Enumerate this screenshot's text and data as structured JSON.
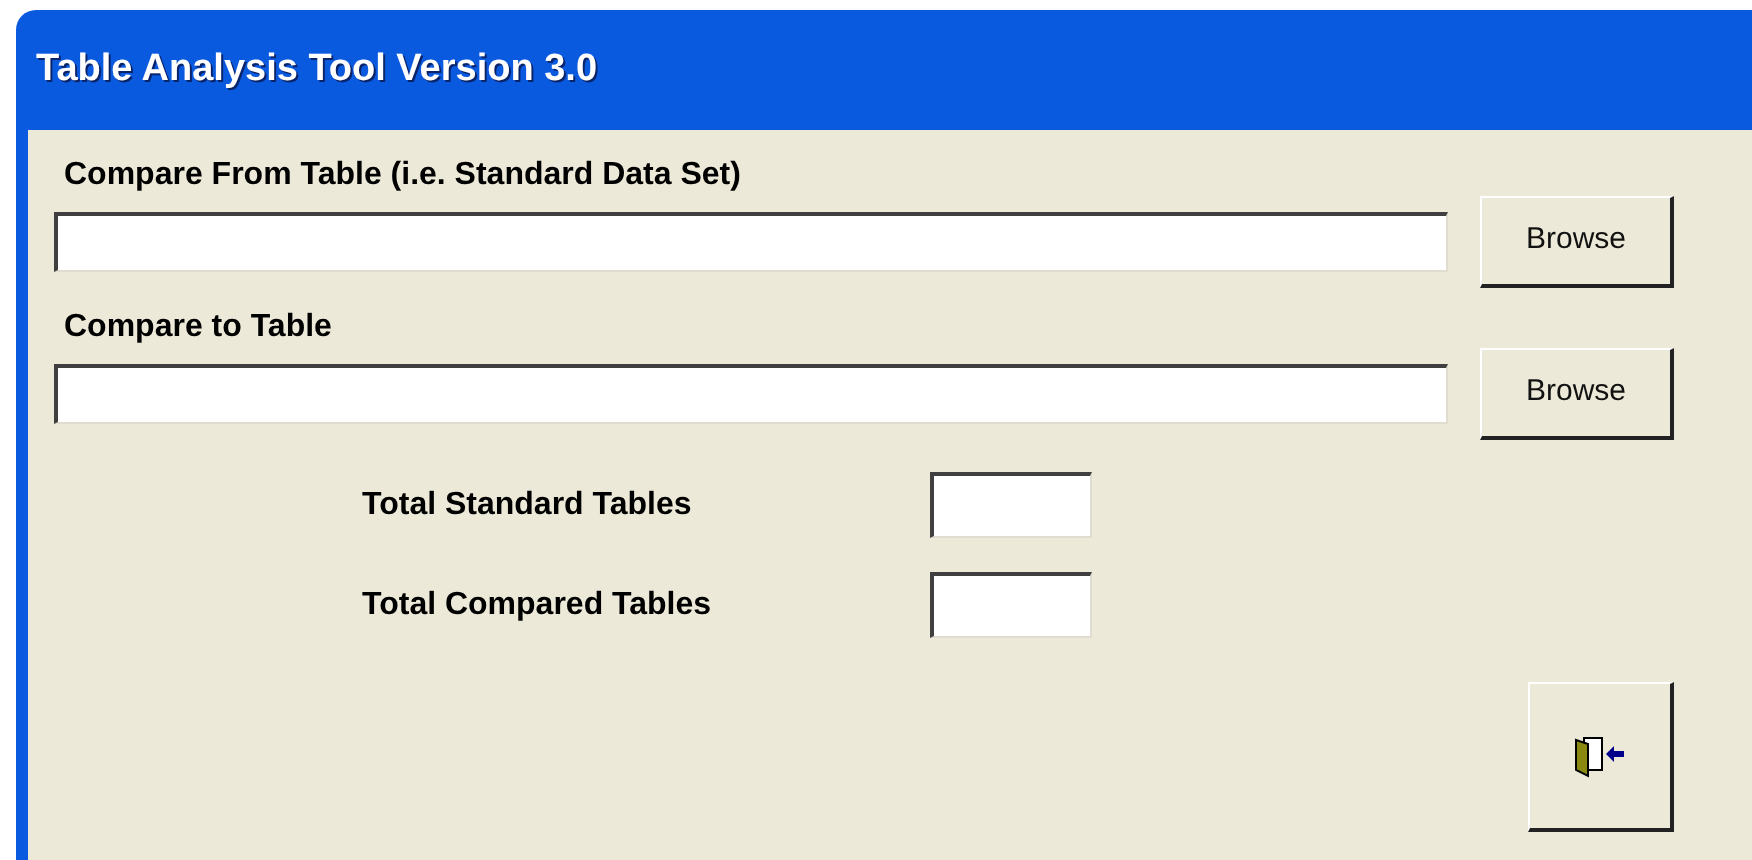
{
  "window": {
    "title": "Table Analysis Tool Version 3.0"
  },
  "from_table": {
    "label": "Compare From Table (i.e. Standard Data Set)",
    "button": "Browse"
  },
  "to_table": {
    "label": "Compare to Table",
    "button": "Browse"
  },
  "totals": [
    {
      "label": "Total Standard Tables"
    },
    {
      "label": "Total Compared Tables"
    }
  ]
}
